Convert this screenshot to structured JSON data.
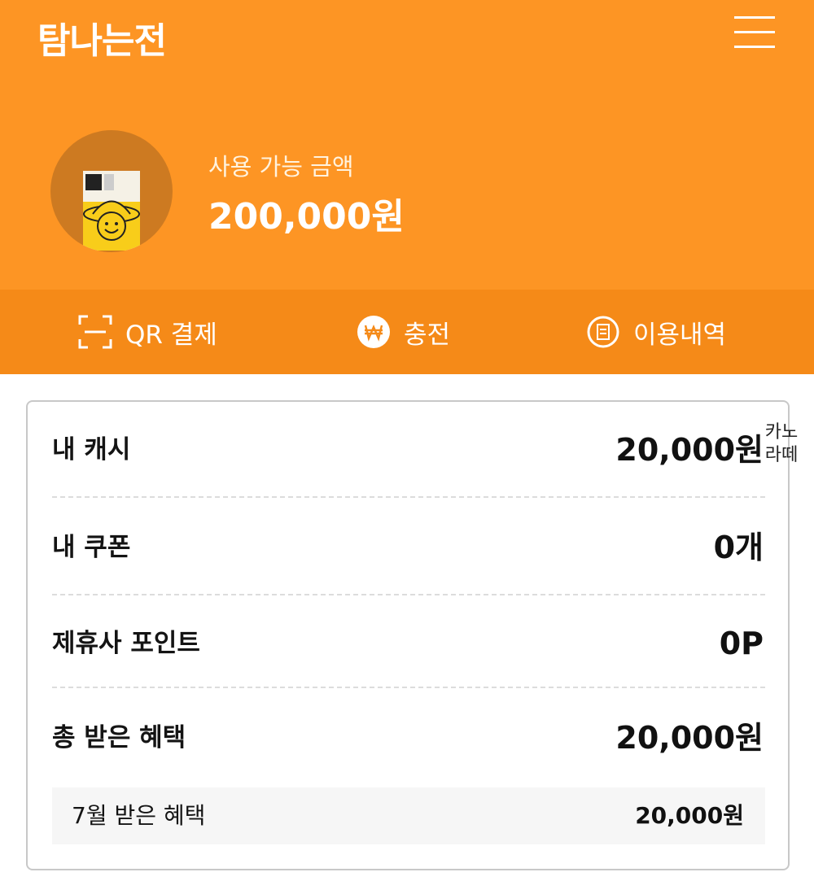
{
  "header": {
    "title": "탐나는전",
    "menu_icon": "hamburger-menu-icon",
    "balance_label": "사용 가능 금액",
    "balance_amount": "200,000원",
    "background_color": "#fd9524"
  },
  "actions": [
    {
      "label": "QR 결제",
      "icon": "qr-scan-icon"
    },
    {
      "label": "충전",
      "icon": "won-circle-icon"
    },
    {
      "label": "이용내역",
      "icon": "history-list-icon"
    }
  ],
  "summary": {
    "rows": [
      {
        "label": "내 캐시",
        "value": "20,000원"
      },
      {
        "label": "내 쿠폰",
        "value": "0개"
      },
      {
        "label": "제휴사 포인트",
        "value": "0P"
      },
      {
        "label": "총 받은 혜택",
        "value": "20,000원"
      }
    ],
    "sub_row": {
      "label": "7월 받은 혜택",
      "value": "20,000원"
    }
  },
  "watermark": {
    "line1": "카노",
    "line2": "라떼"
  }
}
